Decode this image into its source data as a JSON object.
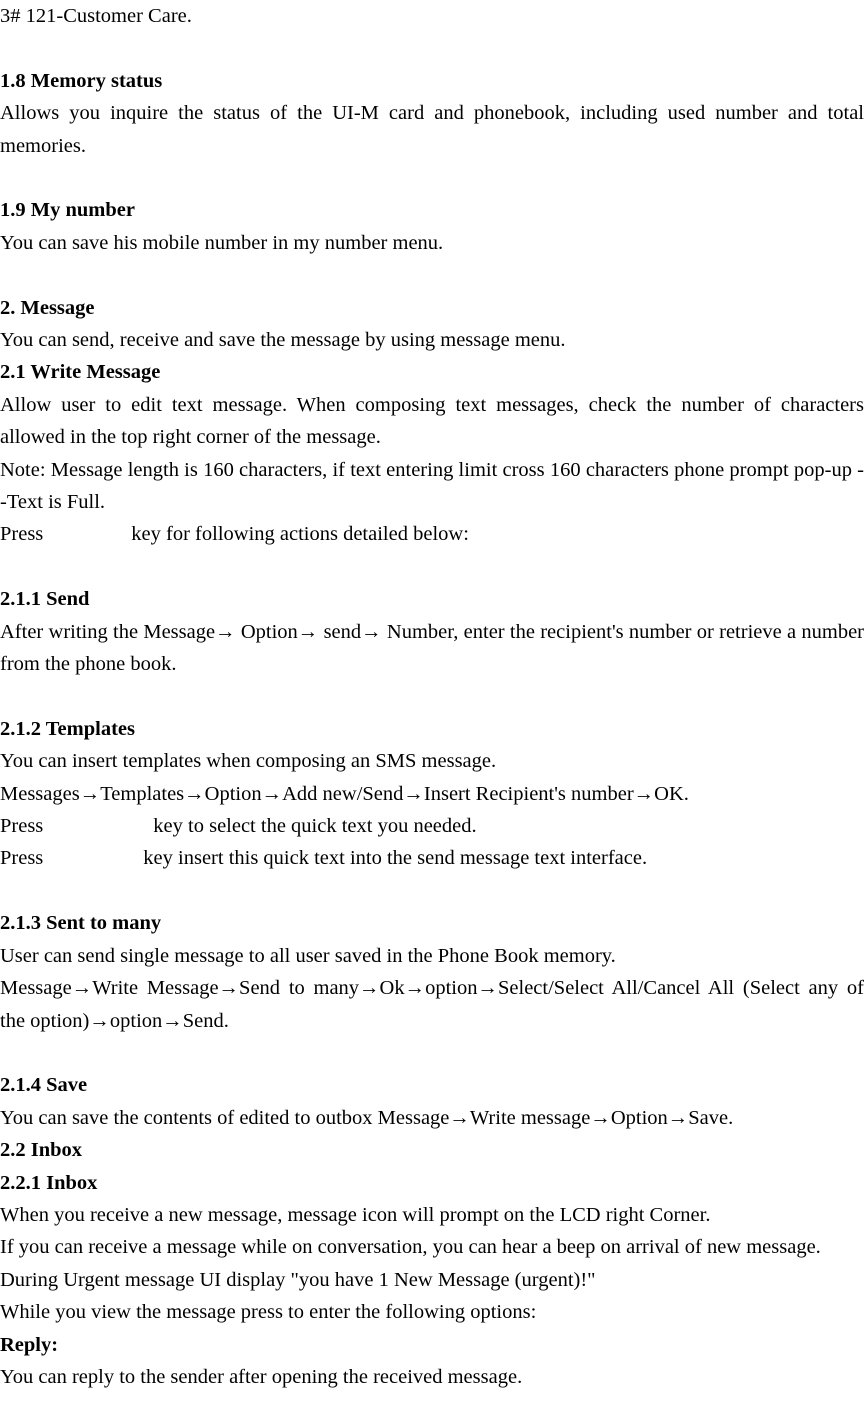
{
  "document": {
    "header_line": "3# 121-Customer Care.",
    "sections": [
      {
        "id": "memory-status",
        "heading": "1.8 Memory status",
        "body": "Allows you inquire the status of the UI-M card and phonebook, including used number and total memories."
      },
      {
        "id": "my-number",
        "heading": "1.9 My number",
        "body": "You can save his mobile number in my number menu."
      },
      {
        "id": "message",
        "heading": "2. Message",
        "body": "You can send, receive and save the message by using message menu."
      },
      {
        "id": "write-message",
        "heading": "2.1 Write Message",
        "body1": "Allow user to edit text message. When composing text messages, check the number of characters allowed in the top right corner of the message.",
        "body2": "Note: Message length is 160 characters, if text entering limit cross 160 characters phone prompt pop-up --Text is Full.",
        "press_prefix": "Press",
        "press_suffix": "key for following actions detailed below:"
      },
      {
        "id": "send",
        "heading": "2.1.1 Send",
        "body": "After writing the Message→  Option→  send→  Number, enter the recipient's number or retrieve a number from the phone book."
      },
      {
        "id": "templates",
        "heading": "2.1.2 Templates",
        "body1": "You can insert templates when composing an SMS message.",
        "body2": "Messages→Templates→Option→Add new/Send→Insert Recipient's number→OK.",
        "press1_prefix": "Press",
        "press1_suffix": "key to select the quick text you needed.",
        "press2_prefix": "Press",
        "press2_suffix": "key insert this quick text into the send message text interface."
      },
      {
        "id": "sent-to-many",
        "heading": "2.1.3 Sent to many",
        "body1": "User can send single message to all user saved in the Phone Book memory.",
        "body2": "Message→Write Message→Send to many→Ok→option→Select/Select All/Cancel All (Select any of the option)→option→Send."
      },
      {
        "id": "save",
        "heading": "2.1.4 Save",
        "body": "You can save the contents of edited to outbox Message→Write message→Option→Save."
      },
      {
        "id": "inbox",
        "heading": "2.2 Inbox"
      },
      {
        "id": "inbox-sub",
        "heading": "2.2.1 Inbox",
        "body1": "When you receive a new message, message icon will prompt on the LCD right Corner.",
        "body2": "If you can receive a message while on conversation, you can hear a beep on arrival of new message.",
        "body3": "During Urgent message UI display \"you have 1 New Message (urgent)!\"",
        "body4": "While you view the message press to enter the following options:"
      },
      {
        "id": "reply",
        "heading": "Reply:",
        "body": "You can reply to the sender after opening the received message."
      }
    ]
  }
}
